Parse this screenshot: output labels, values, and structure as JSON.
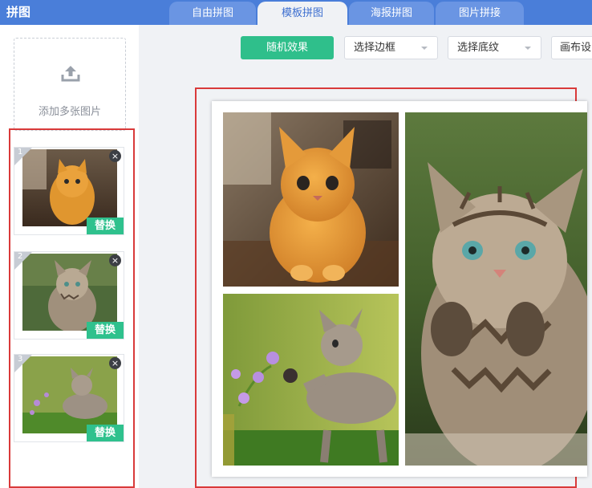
{
  "app": {
    "title": "拼图"
  },
  "tabs": [
    {
      "label": "自由拼图",
      "active": false
    },
    {
      "label": "模板拼图",
      "active": true
    },
    {
      "label": "海报拼图",
      "active": false
    },
    {
      "label": "图片拼接",
      "active": false
    }
  ],
  "sidebar": {
    "add_label": "添加多张图片",
    "thumbs": [
      {
        "num": "1",
        "replace_label": "替换",
        "close": "×",
        "subject": "orange-kitten-photo"
      },
      {
        "num": "2",
        "replace_label": "替换",
        "close": "×",
        "subject": "tabby-kitten-praying-photo"
      },
      {
        "num": "3",
        "replace_label": "替换",
        "close": "×",
        "subject": "tabby-kitten-flowers-photo"
      }
    ]
  },
  "toolbar": {
    "random_label": "随机效果",
    "border_select": "选择边框",
    "texture_select": "选择底纹",
    "canvas_settings": "画布设"
  },
  "colors": {
    "accent": "#4a7ed9",
    "green": "#2fbf8b",
    "highlight": "#d93a3a"
  }
}
